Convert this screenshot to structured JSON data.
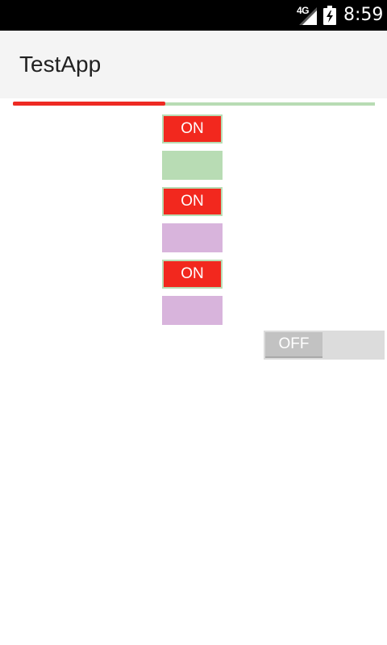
{
  "status_bar": {
    "network_label": "4G",
    "signal_icon": "signal-strength-icon",
    "battery_icon": "battery-charging-icon",
    "time": "8:59"
  },
  "app_bar": {
    "title": "TestApp"
  },
  "progress": {
    "value_fraction": 0.42,
    "fill_color": "#ee2a23",
    "track_color": "#b8dcb4"
  },
  "toggles": [
    {
      "state": "on",
      "label": "ON",
      "color": "#f2281e"
    },
    {
      "state": "off",
      "label": "",
      "color": "#b8dcb4"
    },
    {
      "state": "on",
      "label": "ON",
      "color": "#f2281e"
    },
    {
      "state": "off",
      "label": "",
      "color": "#d8b4dc"
    },
    {
      "state": "on",
      "label": "ON",
      "color": "#f2281e"
    },
    {
      "state": "off",
      "label": "",
      "color": "#d8b4dc"
    }
  ],
  "switch": {
    "state": "off",
    "label": "OFF"
  }
}
